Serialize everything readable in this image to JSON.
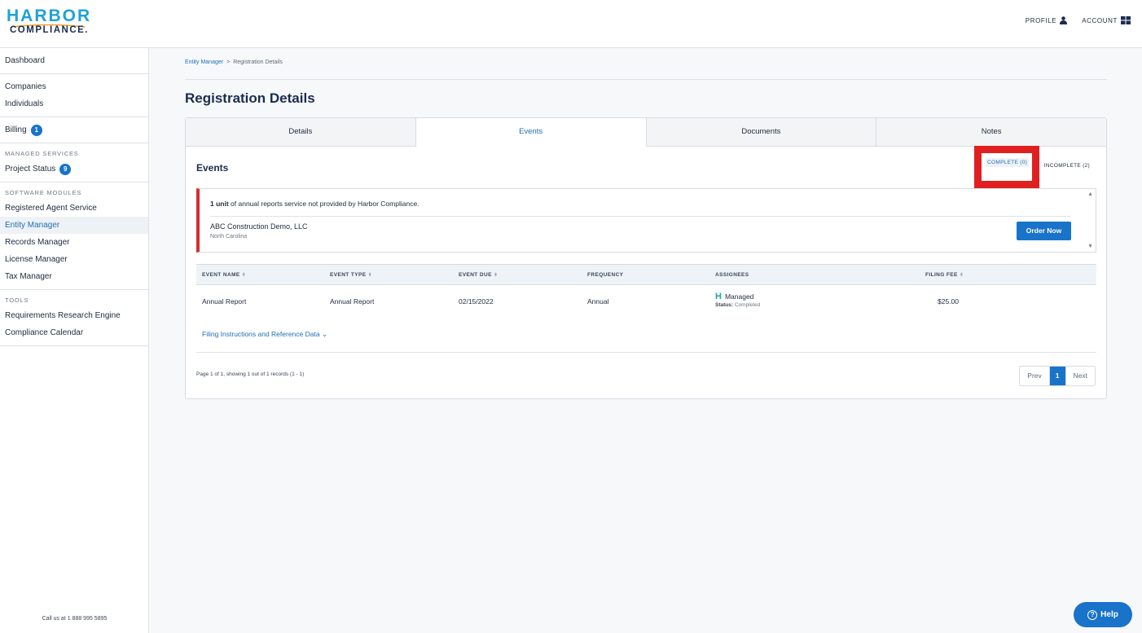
{
  "brand": {
    "line1": "HARBOR",
    "line2": "COMPLIANCE."
  },
  "header": {
    "profile_label": "PROFILE",
    "account_label": "ACCOUNT"
  },
  "sidebar": {
    "dashboard": "Dashboard",
    "companies": "Companies",
    "individuals": "Individuals",
    "billing": "Billing",
    "billing_count": "1",
    "managed_services_heading": "MANAGED SERVICES",
    "project_status": "Project Status",
    "project_status_count": "9",
    "software_modules_heading": "SOFTWARE MODULES",
    "registered_agent": "Registered Agent Service",
    "entity_manager": "Entity Manager",
    "records_manager": "Records Manager",
    "license_manager": "License Manager",
    "tax_manager": "Tax Manager",
    "tools_heading": "TOOLS",
    "requirements": "Requirements Research Engine",
    "compliance_calendar": "Compliance Calendar",
    "footer": "Call us at 1 888 995 5895"
  },
  "breadcrumb": {
    "parent": "Entity Manager",
    "separator": ">",
    "current": "Registration Details"
  },
  "page_title": "Registration Details",
  "tabs": [
    {
      "label": "Details"
    },
    {
      "label": "Events"
    },
    {
      "label": "Documents"
    },
    {
      "label": "Notes"
    }
  ],
  "events": {
    "title": "Events",
    "filter_complete": "COMPLETE (0)",
    "filter_incomplete": "INCOMPLETE (2)",
    "notice": {
      "bold": "1 unit",
      "text": " of annual reports service not provided by Harbor Compliance.",
      "company": "ABC Construction Demo, LLC",
      "state": "North Carolina",
      "button": "Order Now"
    },
    "columns": {
      "name": "EVENT NAME",
      "type": "EVENT TYPE",
      "due": "EVENT DUE",
      "frequency": "FREQUENCY",
      "assignees": "ASSIGNEES",
      "fee": "FILING FEE"
    },
    "row": {
      "name": "Annual Report",
      "type": "Annual Report",
      "due": "02/15/2022",
      "frequency": "Annual",
      "assignee": "Managed",
      "status_label": "Status:",
      "status_value": "Completed",
      "fee": "$25.00"
    },
    "filing_link": "Filing Instructions and Reference Data",
    "page_info": "Page 1 of 1, showing 1 out of 1 records (1 - 1)",
    "pager": {
      "prev": "Prev",
      "current": "1",
      "next": "Next"
    }
  },
  "help_label": "Help",
  "colors": {
    "accent": "#1873c9",
    "brand_teal": "#1ea2d8",
    "alert_red": "#d32f2f",
    "highlight_box": "#e02020"
  }
}
